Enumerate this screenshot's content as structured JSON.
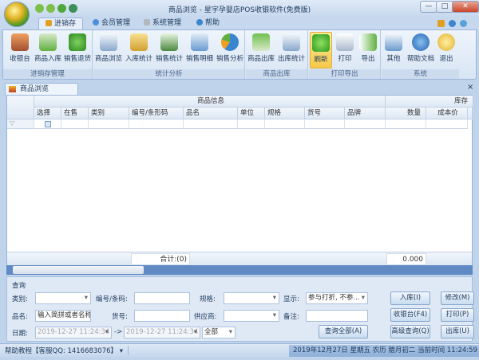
{
  "window": {
    "title": "商品浏览 - 星宇孕婴店POS收银软件(免费版)",
    "minimize": "—",
    "maximize": "□",
    "close": "✕"
  },
  "tabs": [
    {
      "label": "进销存",
      "active": true
    },
    {
      "label": "会员管理"
    },
    {
      "label": "系统管理"
    },
    {
      "label": "帮助"
    }
  ],
  "ribbon": {
    "groups": [
      {
        "label": "进销存管理",
        "buttons": [
          "收银台",
          "商品入库",
          "销售退货"
        ]
      },
      {
        "label": "统计分析",
        "buttons": [
          "商品浏览",
          "入库统计",
          "销售统计",
          "销售明细",
          "销售分析"
        ]
      },
      {
        "label": "商品出库",
        "buttons": [
          "商品出库",
          "出库统计"
        ]
      },
      {
        "label": "打印导出",
        "buttons": [
          "刷新",
          "打印",
          "导出"
        ]
      },
      {
        "label": "系统",
        "buttons": [
          "其他",
          "帮助文档",
          "退出"
        ]
      }
    ]
  },
  "doc_tab": {
    "label": "商品浏览",
    "close": "×"
  },
  "grid": {
    "band_goods": "商品信息",
    "band_stock": "库存",
    "columns": [
      "选择",
      "在售",
      "类别",
      "编号/条形码",
      "品名",
      "单位",
      "规格",
      "货号",
      "品牌",
      "数量",
      "成本价"
    ],
    "rows": [],
    "footer": {
      "total": "合计:(0)",
      "quantity": "0.000"
    }
  },
  "query": {
    "title": "查询",
    "category_label": "类别:",
    "category_value": "",
    "code_label": "编号/条码:",
    "code_value": "",
    "spec_label": "规格:",
    "spec_value": "",
    "display_label": "显示:",
    "display_value": "参与打折, 不参...",
    "name_label": "品名:",
    "name_placeholder": "输入简拼或者名称",
    "item_no_label": "货号:",
    "item_no_value": "",
    "supplier_label": "供应商:",
    "supplier_value": "",
    "note_label": "备注:",
    "note_value": "",
    "date_label": "日期:",
    "date_from": "2019-12-27 11:24:34",
    "date_arrow": "->",
    "date_to": "2019-12-27 11:24:34",
    "range_value": "全部",
    "query_all": "查询全部(A)",
    "buttons": {
      "in": "入库(I)",
      "edit": "修改(M)",
      "cashier": "收银台(F4)",
      "print": "打印(P)",
      "advanced": "高级查询(Q)",
      "out": "出库(U)"
    }
  },
  "status": {
    "left": "帮助教程【客服QQ: 1416683076】",
    "right": "2019年12月27日 星期五 农历 腊月初二 当前时间 11:24:59"
  }
}
